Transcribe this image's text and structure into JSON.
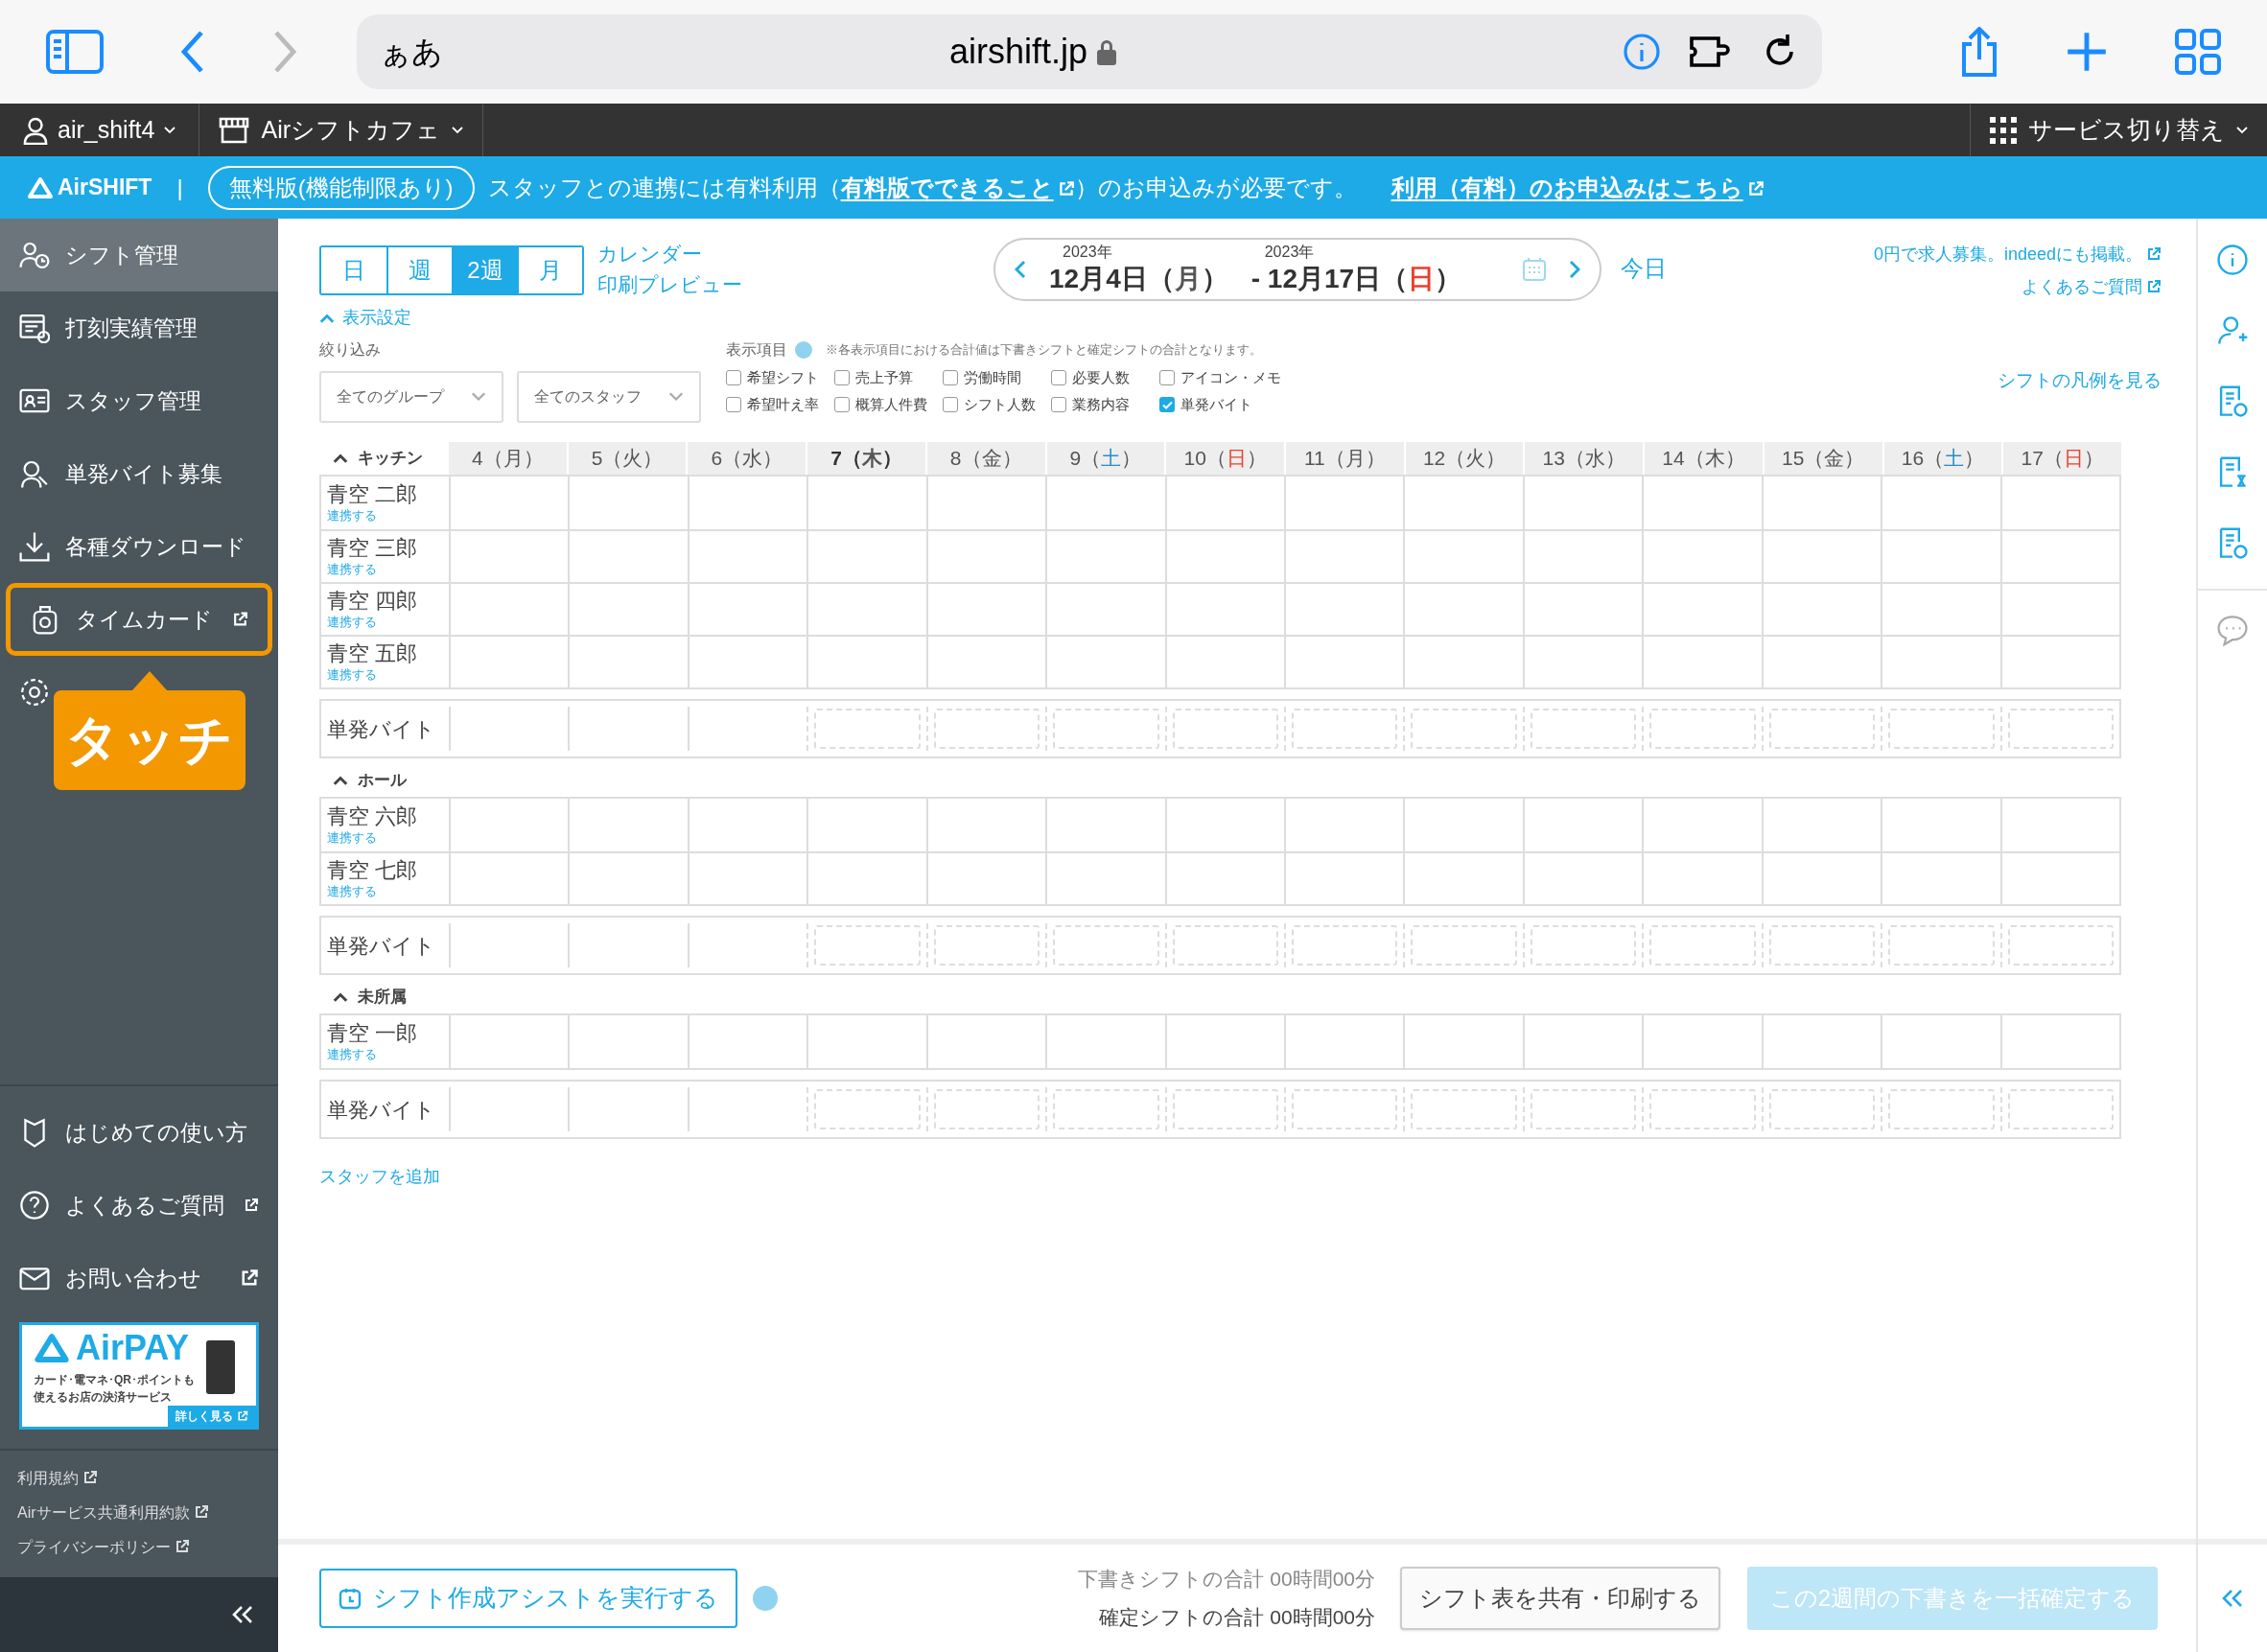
{
  "browser": {
    "text_size": "ぁあ",
    "address": "airshift.jp",
    "forward_disabled": true
  },
  "app_bar": {
    "user": "air_shift4",
    "store": "Airシフトカフェ",
    "service_switch": "サービス切り替え"
  },
  "banner": {
    "logo": "AirSHIFT",
    "separator": "|",
    "plan": "無料版(機能制限あり)",
    "message_before": "スタッフとの連携には有料利用（",
    "message_link": "有料版でできること",
    "message_after": "）のお申込みが必要です。",
    "apply_link": "利用（有料）のお申込みはこちら"
  },
  "sidebar": {
    "items": [
      {
        "label": "シフト管理",
        "selected": true,
        "external": false,
        "highlighted": false
      },
      {
        "label": "打刻実績管理",
        "selected": false,
        "external": false,
        "highlighted": false
      },
      {
        "label": "スタッフ管理",
        "selected": false,
        "external": false,
        "highlighted": false
      },
      {
        "label": "単発バイト募集",
        "selected": false,
        "external": false,
        "highlighted": false
      },
      {
        "label": "各種ダウンロード",
        "selected": false,
        "external": false,
        "highlighted": false
      },
      {
        "label": "タイムカード",
        "selected": false,
        "external": true,
        "highlighted": true
      },
      {
        "selected": false,
        "external": false,
        "highlighted": false
      }
    ],
    "callout": "タッチ",
    "help_items": [
      {
        "label": "はじめての使い方",
        "external": false
      },
      {
        "label": "よくあるご質問",
        "external": true
      },
      {
        "label": "お問い合わせ",
        "external": true
      }
    ],
    "ad": {
      "logo": "AirPAY",
      "line_1": "カード･電マネ･QR･ポイントも",
      "line_2": "使えるお店の決済サービス",
      "more": "詳しく見る"
    },
    "footer_links": [
      "利用規約",
      "Airサービス共通利用約款",
      "プライバシーポリシー"
    ]
  },
  "view_tabs": [
    {
      "label": "日",
      "selected": false
    },
    {
      "label": "週",
      "selected": false
    },
    {
      "label": "2週",
      "selected": true
    },
    {
      "label": "月",
      "selected": false
    }
  ],
  "view_links": [
    "カレンダー",
    "印刷プレビュー"
  ],
  "weekday_brackets": [
    "（",
    "）"
  ],
  "period": {
    "start": {
      "year": "2023年",
      "date": "12月4日",
      "weekday": "月",
      "kind": "weekday"
    },
    "end": {
      "year": "2023年",
      "prefix": "- ",
      "date": "12月17日",
      "weekday": "日",
      "kind": "sunday"
    },
    "today": "今日"
  },
  "top_links": [
    "0円で求人募集。indeedにも掲載。",
    "よくあるご質問"
  ],
  "display_settings": {
    "label": "表示設定",
    "expanded": true
  },
  "filter": {
    "label": "絞り込み",
    "group": "全てのグループ",
    "staff": "全てのスタッフ"
  },
  "display_items": {
    "label": "表示項目",
    "note": "※各表示項目における合計値は下書きシフトと確定シフトの合計となります。",
    "options": [
      {
        "label": "希望シフト",
        "checked": false
      },
      {
        "label": "売上予算",
        "checked": false
      },
      {
        "label": "労働時間",
        "checked": false
      },
      {
        "label": "必要人数",
        "checked": false
      },
      {
        "label": "アイコン・メモ",
        "checked": false
      },
      {
        "label": "希望叶え率",
        "checked": false
      },
      {
        "label": "概算人件費",
        "checked": false
      },
      {
        "label": "シフト人数",
        "checked": false
      },
      {
        "label": "業務内容",
        "checked": false
      },
      {
        "label": "単発バイト",
        "checked": true
      }
    ]
  },
  "legend_link": "シフトの凡例を見る",
  "days": [
    {
      "date": "4",
      "weekday": "月",
      "kind": "weekday",
      "today": false,
      "past": true
    },
    {
      "date": "5",
      "weekday": "火",
      "kind": "weekday",
      "today": false,
      "past": true
    },
    {
      "date": "6",
      "weekday": "水",
      "kind": "weekday",
      "today": false,
      "past": true
    },
    {
      "date": "7",
      "weekday": "木",
      "kind": "weekday",
      "today": true,
      "past": false
    },
    {
      "date": "8",
      "weekday": "金",
      "kind": "weekday",
      "today": false,
      "past": false
    },
    {
      "date": "9",
      "weekday": "土",
      "kind": "saturday",
      "today": false,
      "past": false
    },
    {
      "date": "10",
      "weekday": "日",
      "kind": "sunday",
      "today": false,
      "past": false
    },
    {
      "date": "11",
      "weekday": "月",
      "kind": "weekday",
      "today": false,
      "past": false
    },
    {
      "date": "12",
      "weekday": "火",
      "kind": "weekday",
      "today": false,
      "past": false
    },
    {
      "date": "13",
      "weekday": "水",
      "kind": "weekday",
      "today": false,
      "past": false
    },
    {
      "date": "14",
      "weekday": "木",
      "kind": "weekday",
      "today": false,
      "past": false
    },
    {
      "date": "15",
      "weekday": "金",
      "kind": "weekday",
      "today": false,
      "past": false
    },
    {
      "date": "16",
      "weekday": "土",
      "kind": "saturday",
      "today": false,
      "past": false
    },
    {
      "date": "17",
      "weekday": "日",
      "kind": "sunday",
      "today": false,
      "past": false
    }
  ],
  "groups": [
    {
      "name": "キッチン",
      "expanded": true,
      "staff": [
        {
          "name": "青空 二郎",
          "link": "連携する"
        },
        {
          "name": "青空 三郎",
          "link": "連携する"
        },
        {
          "name": "青空 四郎",
          "link": "連携する"
        },
        {
          "name": "青空 五郎",
          "link": "連携する"
        }
      ],
      "single_job": "単発バイト"
    },
    {
      "name": "ホール",
      "expanded": true,
      "staff": [
        {
          "name": "青空 六郎",
          "link": "連携する"
        },
        {
          "name": "青空 七郎",
          "link": "連携する"
        }
      ],
      "single_job": "単発バイト"
    },
    {
      "name": "未所属",
      "expanded": true,
      "staff": [
        {
          "name": "青空 一郎",
          "link": "連携する"
        }
      ],
      "single_job": "単発バイト"
    }
  ],
  "add_staff": "スタッフを追加",
  "bottom_bar": {
    "assist": "シフト作成アシストを実行する",
    "draft_total": "下書きシフトの合計 00時間00分",
    "confirmed_total": "確定シフトの合計 00時間00分",
    "share": "シフト表を共有・印刷する",
    "confirm": "この2週間の下書きを一括確定する",
    "confirm_disabled": true
  }
}
